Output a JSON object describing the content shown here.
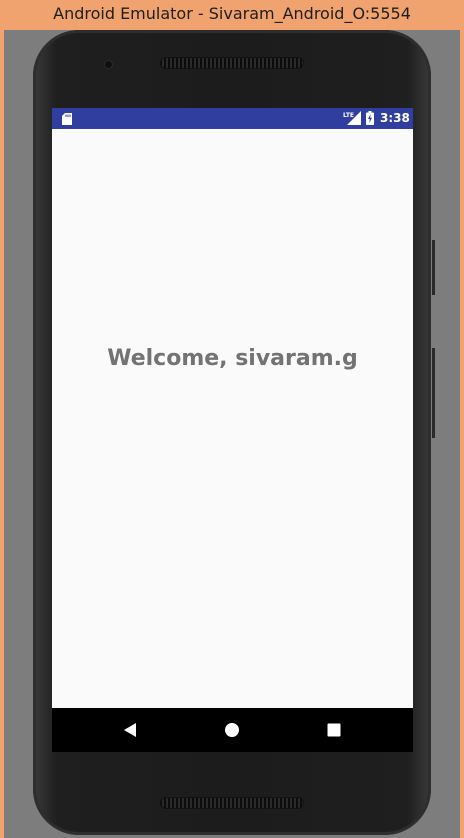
{
  "window": {
    "title": "Android Emulator - Sivaram_Android_O:5554"
  },
  "status_bar": {
    "time": "3:38",
    "network": "LTE",
    "icons": [
      "sd-card-icon",
      "lte-signal-icon",
      "battery-charging-icon"
    ]
  },
  "app": {
    "welcome_text": "Welcome, sivaram.g"
  },
  "nav_bar": {
    "icons": [
      "back-icon",
      "home-icon",
      "recents-icon"
    ]
  },
  "colors": {
    "status_bar": "#303f9f",
    "screen_bg": "#fafafa",
    "welcome_text": "#737373",
    "nav_bar": "#000000",
    "window_border": "#f0a36f"
  }
}
